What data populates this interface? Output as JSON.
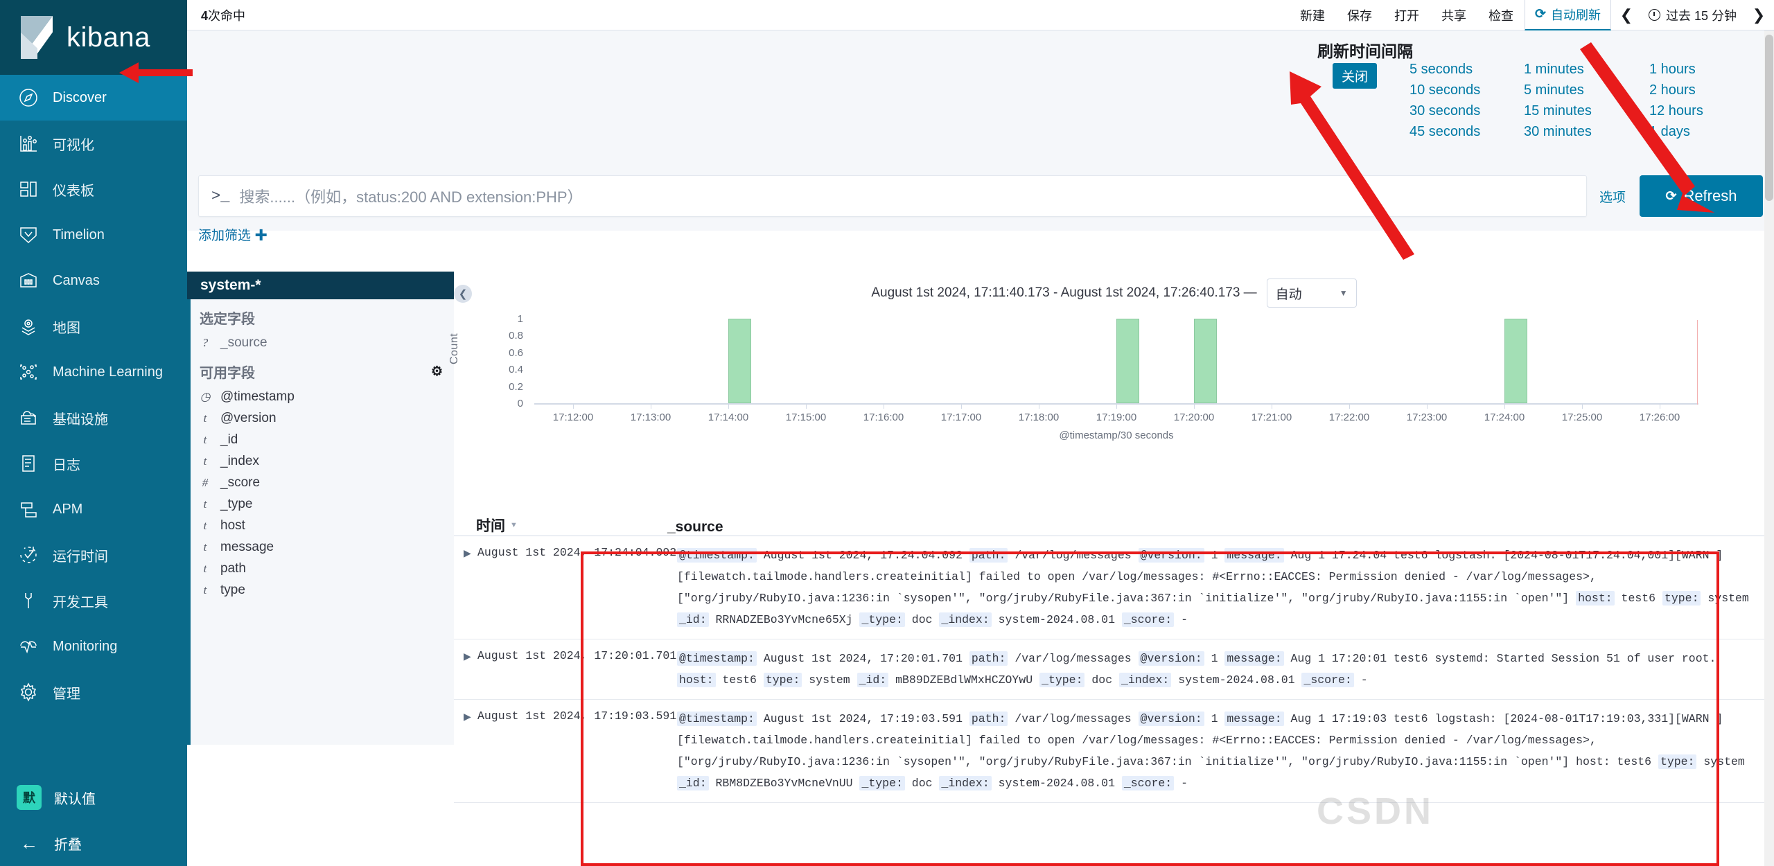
{
  "app": {
    "brand": "kibana"
  },
  "sidebar": {
    "items": [
      {
        "label": "Discover",
        "icon": "compass-icon",
        "active": true
      },
      {
        "label": "可视化",
        "icon": "chart-icon",
        "active": false
      },
      {
        "label": "仪表板",
        "icon": "dashboard-icon",
        "active": false
      },
      {
        "label": "Timelion",
        "icon": "timelion-icon",
        "active": false
      },
      {
        "label": "Canvas",
        "icon": "canvas-icon",
        "active": false
      },
      {
        "label": "地图",
        "icon": "map-icon",
        "active": false
      },
      {
        "label": "Machine Learning",
        "icon": "ml-icon",
        "active": false
      },
      {
        "label": "基础设施",
        "icon": "infrastructure-icon",
        "active": false
      },
      {
        "label": "日志",
        "icon": "logs-icon",
        "active": false
      },
      {
        "label": "APM",
        "icon": "apm-icon",
        "active": false
      },
      {
        "label": "运行时间",
        "icon": "uptime-icon",
        "active": false
      },
      {
        "label": "开发工具",
        "icon": "devtools-icon",
        "active": false
      },
      {
        "label": "Monitoring",
        "icon": "monitoring-icon",
        "active": false
      },
      {
        "label": "管理",
        "icon": "gear-icon",
        "active": false
      }
    ],
    "space": {
      "badge": "默",
      "label": "默认值"
    },
    "collapse_label": "折叠"
  },
  "topbar": {
    "hits_number": "4",
    "hits_suffix": "次命中",
    "actions": [
      "新建",
      "保存",
      "打开",
      "共享",
      "检查"
    ],
    "autorefresh_label": "自动刷新",
    "time_range_label": "过去 15 分钟",
    "prev_glyph": "❮",
    "next_glyph": "❯"
  },
  "refresh_popover": {
    "title": "刷新时间间隔",
    "off_label": "关闭",
    "seconds": [
      "5 seconds",
      "10 seconds",
      "30 seconds",
      "45 seconds"
    ],
    "minutes": [
      "1 minutes",
      "5 minutes",
      "15 minutes",
      "30 minutes"
    ],
    "hours": [
      "1 hours",
      "2 hours",
      "12 hours",
      "1 days"
    ]
  },
  "query": {
    "prompt": ">_",
    "placeholder": "搜索......（例如，status:200 AND extension:PHP）",
    "options_label": "选项",
    "refresh_label": "Refresh",
    "add_filter_label": "添加筛选"
  },
  "fields": {
    "index_pattern": "system-*",
    "selected_title": "选定字段",
    "selected": [
      {
        "type": "?",
        "name": "_source"
      }
    ],
    "available_title": "可用字段",
    "available": [
      {
        "type": "◷",
        "name": "@timestamp"
      },
      {
        "type": "t",
        "name": "@version"
      },
      {
        "type": "t",
        "name": "_id"
      },
      {
        "type": "t",
        "name": "_index"
      },
      {
        "type": "#",
        "name": "_score"
      },
      {
        "type": "t",
        "name": "_type"
      },
      {
        "type": "t",
        "name": "host"
      },
      {
        "type": "t",
        "name": "message"
      },
      {
        "type": "t",
        "name": "path"
      },
      {
        "type": "t",
        "name": "type"
      }
    ]
  },
  "chart_header": {
    "range": "August 1st 2024, 17:11:40.173 - August 1st 2024, 17:26:40.173 —",
    "interval_value": "自动"
  },
  "chart_data": {
    "type": "bar",
    "title": "",
    "xlabel": "@timestamp/30 seconds",
    "ylabel": "Count",
    "ylim": [
      0,
      1
    ],
    "yticks": [
      "0",
      "0.2",
      "0.4",
      "0.6",
      "0.8",
      "1"
    ],
    "xticks": [
      "17:12:00",
      "17:13:00",
      "17:14:00",
      "17:15:00",
      "17:16:00",
      "17:17:00",
      "17:18:00",
      "17:19:00",
      "17:20:00",
      "17:21:00",
      "17:22:00",
      "17:23:00",
      "17:24:00",
      "17:25:00",
      "17:26:00"
    ],
    "categories": [
      "17:14:00",
      "17:19:00",
      "17:20:00",
      "17:24:00"
    ],
    "values": [
      1,
      1,
      1,
      1
    ],
    "grid": false,
    "legend": "none",
    "bar_color": "#a3dfb5"
  },
  "table": {
    "col_time": "时间",
    "col_source": "_source",
    "rows": [
      {
        "time": "August 1st 2024, 17:24:04.092",
        "parts": [
          {
            "k": "@timestamp:",
            "v": "August 1st 2024, 17:24:04.092"
          },
          {
            "k": "path:",
            "v": "/var/log/messages"
          },
          {
            "k": "@version:",
            "v": "1"
          },
          {
            "k": "message:",
            "v": "Aug 1 17:24:04 test6 logstash: [2024-08-01T17:24:04,001][WARN ][filewatch.tailmode.handlers.createinitial] failed to open /var/log/messages: #<Errno::EACCES: Permission denied - /var/log/messages>, [\"org/jruby/RubyIO.java:1236:in `sysopen'\", \"org/jruby/RubyFile.java:367:in `initialize'\", \"org/jruby/RubyIO.java:1155:in `open'\"]"
          },
          {
            "k": "host:",
            "v": "test6"
          },
          {
            "k": "type:",
            "v": "system"
          },
          {
            "k": "_id:",
            "v": "RRNADZEBo3YvMcne65Xj"
          },
          {
            "k": "_type:",
            "v": "doc"
          },
          {
            "k": "_index:",
            "v": "system-2024.08.01"
          },
          {
            "k": "_score:",
            "v": "-"
          }
        ]
      },
      {
        "time": "August 1st 2024, 17:20:01.701",
        "parts": [
          {
            "k": "@timestamp:",
            "v": "August 1st 2024, 17:20:01.701"
          },
          {
            "k": "path:",
            "v": "/var/log/messages"
          },
          {
            "k": "@version:",
            "v": "1"
          },
          {
            "k": "message:",
            "v": "Aug 1 17:20:01 test6 systemd: Started Session 51 of user root."
          },
          {
            "k": "host:",
            "v": "test6"
          },
          {
            "k": "type:",
            "v": "system"
          },
          {
            "k": "_id:",
            "v": "mB89DZEBdlWMxHCZOYwU"
          },
          {
            "k": "_type:",
            "v": "doc"
          },
          {
            "k": "_index:",
            "v": "system-2024.08.01"
          },
          {
            "k": "_score:",
            "v": "-"
          }
        ]
      },
      {
        "time": "August 1st 2024, 17:19:03.591",
        "parts": [
          {
            "k": "@timestamp:",
            "v": "August 1st 2024, 17:19:03.591"
          },
          {
            "k": "path:",
            "v": "/var/log/messages"
          },
          {
            "k": "@version:",
            "v": "1"
          },
          {
            "k": "message:",
            "v": "Aug 1 17:19:03 test6 logstash: [2024-08-01T17:19:03,331][WARN ][filewatch.tailmode.handlers.createinitial] failed to open /var/log/messages: #<Errno::EACCES: Permission denied - /var/log/messages>, [\"org/jruby/RubyIO.java:1236:in `sysopen'\", \"org/jruby/RubyFile.java:367:in `initialize'\", \"org/jruby/RubyIO.java:1155:in `open'\"] host: test6"
          },
          {
            "k": "type:",
            "v": "system"
          },
          {
            "k": "_id:",
            "v": "RBM8DZEBo3YvMcneVnUU"
          },
          {
            "k": "_type:",
            "v": "doc"
          },
          {
            "k": "_index:",
            "v": "system-2024.08.01"
          },
          {
            "k": "_score:",
            "v": "-"
          }
        ]
      }
    ]
  },
  "watermark": "CSDN",
  "colors": {
    "sidebar": "#0a6a8a",
    "sidebar_dark": "#07485c",
    "accent": "#0079a5",
    "annotation_red": "#e81b1b",
    "bar_green": "#a3dfb5"
  }
}
